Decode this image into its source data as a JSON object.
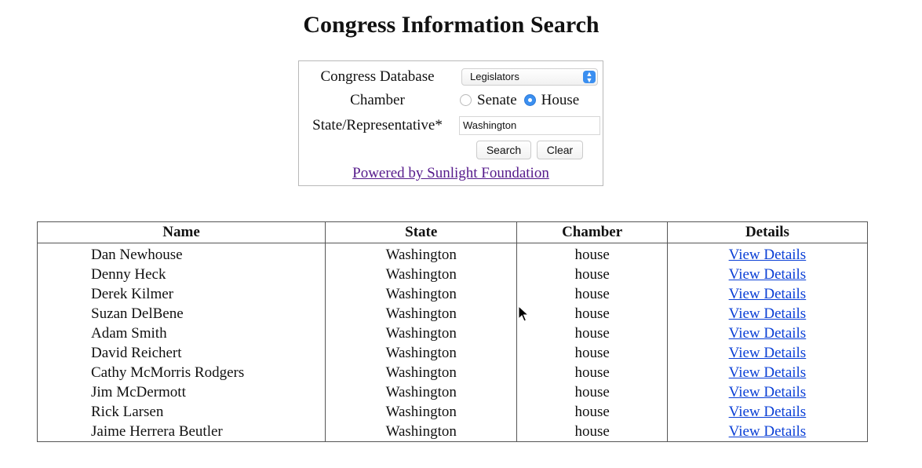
{
  "page": {
    "title": "Congress Information Search"
  },
  "form": {
    "database_label": "Congress Database",
    "database_value": "Legislators",
    "chamber_label": "Chamber",
    "chamber_options": [
      "Senate",
      "House"
    ],
    "chamber_selected": "House",
    "keyword_label": "State/Representative*",
    "keyword_value": "Washington",
    "search_label": "Search",
    "clear_label": "Clear",
    "powered_by": "Powered by Sunlight Foundation"
  },
  "table": {
    "headers": [
      "Name",
      "State",
      "Chamber",
      "Details"
    ],
    "details_link": "View Details",
    "rows": [
      {
        "name": "Dan Newhouse",
        "state": "Washington",
        "chamber": "house"
      },
      {
        "name": "Denny Heck",
        "state": "Washington",
        "chamber": "house"
      },
      {
        "name": "Derek Kilmer",
        "state": "Washington",
        "chamber": "house"
      },
      {
        "name": "Suzan DelBene",
        "state": "Washington",
        "chamber": "house"
      },
      {
        "name": "Adam Smith",
        "state": "Washington",
        "chamber": "house"
      },
      {
        "name": "David Reichert",
        "state": "Washington",
        "chamber": "house"
      },
      {
        "name": "Cathy McMorris Rodgers",
        "state": "Washington",
        "chamber": "house"
      },
      {
        "name": "Jim McDermott",
        "state": "Washington",
        "chamber": "house"
      },
      {
        "name": "Rick Larsen",
        "state": "Washington",
        "chamber": "house"
      },
      {
        "name": "Jaime Herrera Beutler",
        "state": "Washington",
        "chamber": "house"
      }
    ]
  },
  "colors": {
    "link_visited": "#551a8b",
    "link": "#0a3fd6",
    "accent": "#3b8ff0"
  },
  "icons": {
    "select_arrow": "updown-chevron-icon",
    "cursor": "mouse-pointer-icon"
  }
}
